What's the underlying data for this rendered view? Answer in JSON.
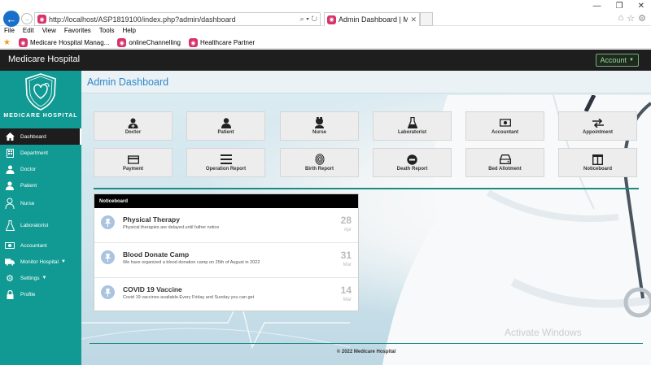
{
  "browser": {
    "url": "http://localhost/ASP1819100/index.php?admin/dashboard",
    "tab_title": "Admin Dashboard | Medica...",
    "menu": [
      "File",
      "Edit",
      "View",
      "Favorites",
      "Tools",
      "Help"
    ],
    "favorites": [
      "Medicare Hospital Manag...",
      "onlineChannelling",
      "Healthcare Partner"
    ]
  },
  "header": {
    "brand": "Medicare Hospital",
    "account_label": "Account"
  },
  "sidebar": {
    "logo_text": "MEDICARE HOSPITAL",
    "items": [
      {
        "label": "Dashboard",
        "icon": "home-icon"
      },
      {
        "label": "Department",
        "icon": "building-icon"
      },
      {
        "label": "Doctor",
        "icon": "doctor-icon"
      },
      {
        "label": "Patient",
        "icon": "user-icon"
      },
      {
        "label": "Nurse",
        "icon": "nurse-icon"
      },
      {
        "label": "Laboratorist",
        "icon": "flask-icon"
      },
      {
        "label": "Accountant",
        "icon": "money-icon"
      },
      {
        "label": "Monitor Hospital",
        "icon": "ambulance-icon"
      },
      {
        "label": "Settings",
        "icon": "gear-icon"
      },
      {
        "label": "Profile",
        "icon": "lock-icon"
      }
    ]
  },
  "main": {
    "title": "Admin Dashboard",
    "tiles": [
      {
        "label": "Doctor",
        "icon": "doctor-icon"
      },
      {
        "label": "Patient",
        "icon": "user-icon"
      },
      {
        "label": "Nurse",
        "icon": "nurse-icon"
      },
      {
        "label": "Laboratorist",
        "icon": "flask-icon"
      },
      {
        "label": "Accountant",
        "icon": "money-icon"
      },
      {
        "label": "Appointment",
        "icon": "exchange-icon"
      },
      {
        "label": "Payment",
        "icon": "credit-card-icon"
      },
      {
        "label": "Operation Report",
        "icon": "menu-icon"
      },
      {
        "label": "Birth Report",
        "icon": "fingerprint-icon"
      },
      {
        "label": "Death Report",
        "icon": "minus-circle-icon"
      },
      {
        "label": "Bed Allotment",
        "icon": "hdd-icon"
      },
      {
        "label": "Noticeboard",
        "icon": "columns-icon"
      }
    ],
    "noticeboard": {
      "title": "Noticeboard",
      "items": [
        {
          "title": "Physical Therapy",
          "desc": "Physical therapies are delayed until futher notice",
          "day": "28",
          "month": "Apr"
        },
        {
          "title": "Blood Donate Camp",
          "desc": "We have organized a blood donation camp on 25th of August in 2022",
          "day": "31",
          "month": "Mar"
        },
        {
          "title": "COVID 19 Vaccine",
          "desc": "Covid 19 vaccines available.Every Friday and Sunday you can get",
          "day": "14",
          "month": "Mar"
        }
      ]
    },
    "footer": "© 2022 Medicare Hospital",
    "watermark": "Activate Windows"
  },
  "colors": {
    "sidebar": "#119a93",
    "header": "#1e1e1e",
    "title": "#2f86c8",
    "accent": "#1a8b82"
  }
}
